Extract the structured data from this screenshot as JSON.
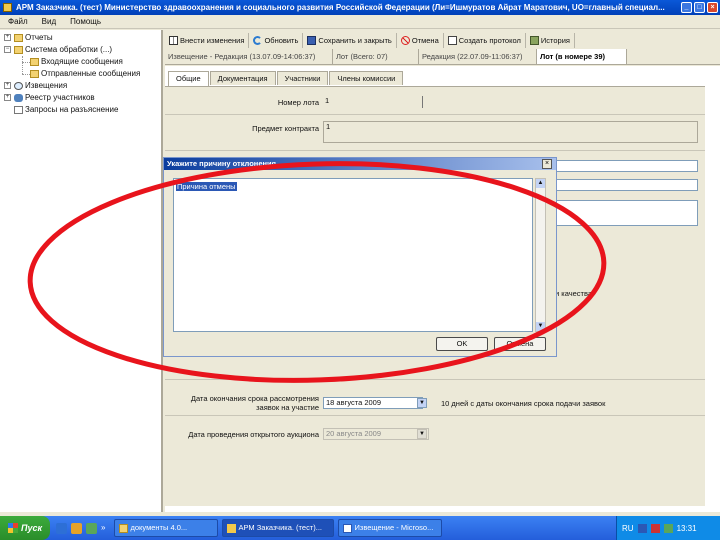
{
  "window": {
    "title": "АРМ Заказчика. (тест) Министерство здравоохранения и социального развития Российской Федерации (Ли=Ишмуратов Айрат Маратович, UO=главный специал...",
    "buttons": [
      "_",
      "□",
      "×"
    ]
  },
  "menu": [
    "Файл",
    "Вид",
    "Помощь"
  ],
  "tree": {
    "items": [
      {
        "label": "Отчеты",
        "icon": "folder-icon"
      },
      {
        "label": "Система обработки (...)",
        "icon": "folder-icon"
      },
      {
        "label": "Входящие сообщения",
        "icon": "folder-icon"
      },
      {
        "label": "Отправленные сообщения",
        "icon": "folder-icon"
      },
      {
        "label": "Извещения",
        "icon": "search-icon"
      },
      {
        "label": "Реестр участников",
        "icon": "people-icon"
      },
      {
        "label": "Запросы на разъяснение",
        "icon": "document-icon"
      }
    ]
  },
  "toolbar": {
    "items": [
      {
        "label": "Внести изменения",
        "icon": "grid-icon"
      },
      {
        "label": "Обновить",
        "icon": "refresh-icon"
      },
      {
        "label": "Сохранить и закрыть",
        "icon": "floppy-icon"
      },
      {
        "label": "Отмена",
        "icon": "cancel-icon"
      },
      {
        "label": "Создать протокол",
        "icon": "new-document-icon"
      },
      {
        "label": "История",
        "icon": "history-icon"
      }
    ]
  },
  "doc_tabs": [
    "Извещение - Редакция (13.07.09-14:06:37)",
    "Лот (Всего: 07)",
    "Редакция (22.07.09-11:06:37)",
    "Лот (в номере 39)"
  ],
  "sub_tabs": [
    "Общие",
    "Документация",
    "Участники",
    "Члены комиссии"
  ],
  "form": {
    "lot_number_label": "Номер лота",
    "lot_number_value": "1",
    "contract_label": "Предмет контракта",
    "contract_value": "1",
    "quality_note": "и качества",
    "deadline_label": "Дата окончания срока рассмотрения заявок на участие",
    "deadline_value": "18 августа 2009",
    "deadline_note": "10 дней с даты окончания срока подачи заявок",
    "opening_label": "Дата проведения открытого аукциона",
    "opening_value": "20 августа 2009"
  },
  "dialog": {
    "title": "Укажите причину отклонения",
    "text": "Причина отмены",
    "ok_label": "OK",
    "cancel_label": "Отмена",
    "close_label": "×"
  },
  "taskbar": {
    "start_label": "Пуск",
    "quicklaunch_more": "»",
    "tasks": [
      {
        "label": "документы 4.0...",
        "icon": "folder-icon",
        "active": false
      },
      {
        "label": "АРМ Заказчика. (тест)...",
        "icon": "app-icon",
        "active": true
      },
      {
        "label": "Извещение - Microso...",
        "icon": "document-icon",
        "active": false
      }
    ],
    "language": "RU",
    "clock": "13:31"
  },
  "colors": {
    "annotation_ring": "#e8141c",
    "titlebar": "#0a58d8",
    "dialog_title": "#0b3d9e"
  }
}
